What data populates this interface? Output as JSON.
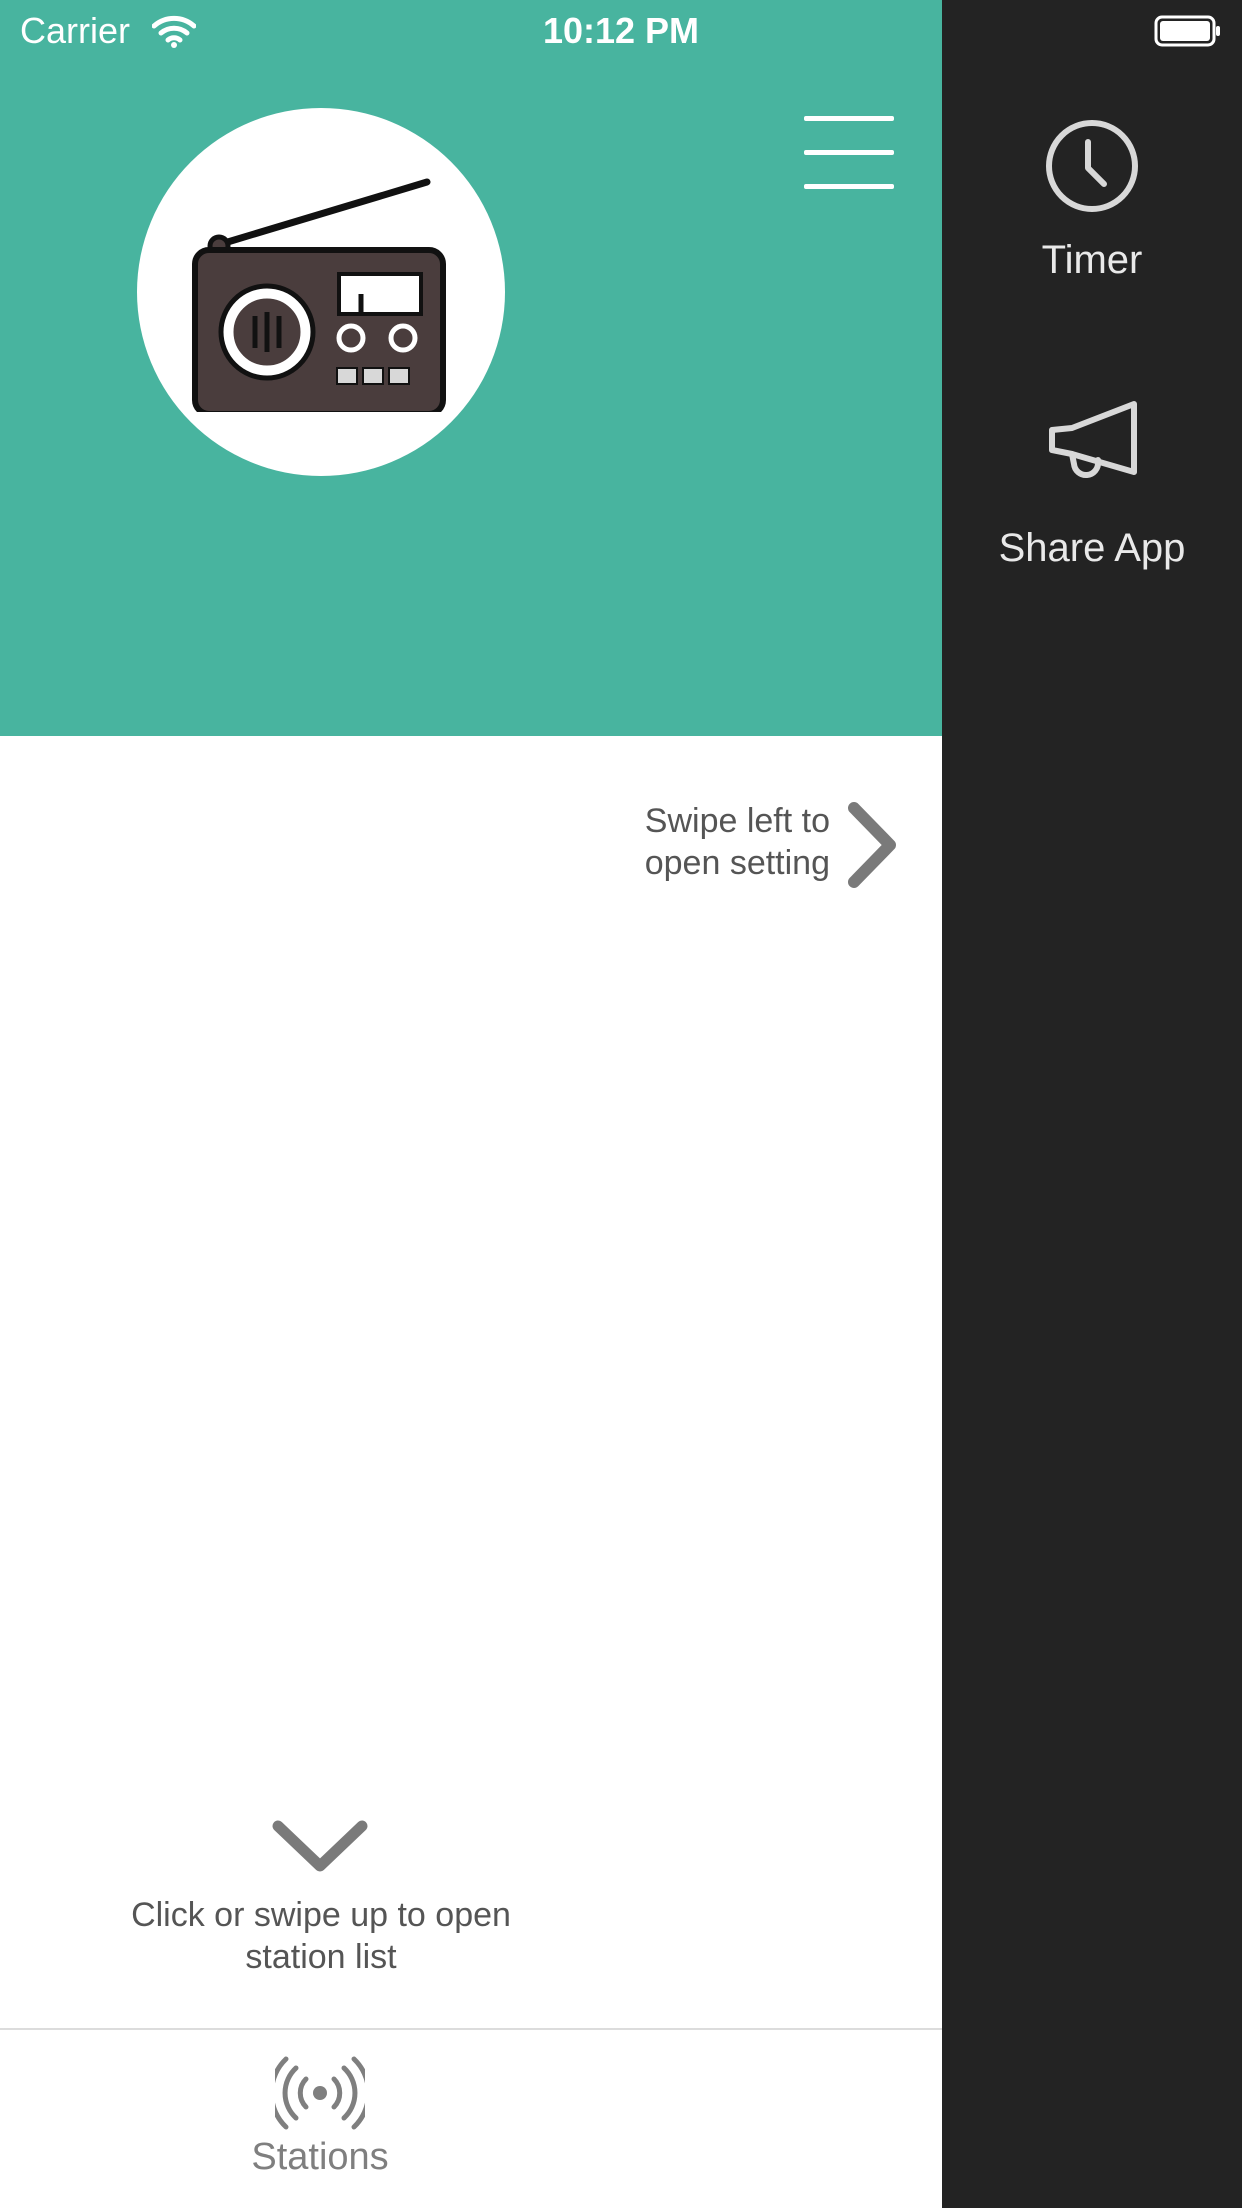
{
  "status_bar": {
    "carrier": "Carrier",
    "time": "10:12 PM"
  },
  "drawer": {
    "items": [
      {
        "label": "Timer",
        "icon": "clock-icon"
      },
      {
        "label": "Share App",
        "icon": "megaphone-icon"
      }
    ]
  },
  "header": {
    "logo_icon": "radio-icon",
    "menu_icon": "hamburger-menu-icon",
    "background_color": "#48b49f"
  },
  "hints": {
    "swipe_left": "Swipe left to open setting",
    "open_station_list": "Click or swipe up to open station list"
  },
  "tabbar": {
    "stations_label": "Stations",
    "stations_icon": "broadcast-icon"
  },
  "colors": {
    "accent": "#48b49f",
    "drawer_bg": "#232323"
  }
}
